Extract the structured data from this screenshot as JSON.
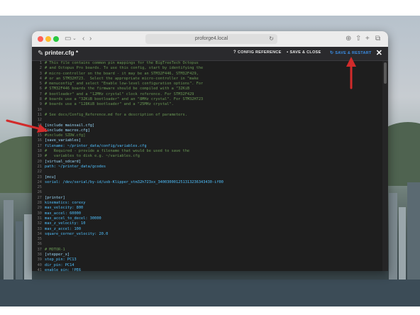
{
  "browser": {
    "url": "proforge4.local"
  },
  "editor": {
    "file_title": "printer.cfg *",
    "buttons": {
      "config_reference": "CONFIG REFERENCE",
      "save_close": "SAVE & CLOSE",
      "save_restart": "SAVE & RESTART"
    },
    "close_label": "✕"
  },
  "code_lines": [
    {
      "n": "1",
      "t": "# This file contains common pin mappings for the BigTreeTech Octopus"
    },
    {
      "n": "2",
      "t": "# and Octopus Pro boards. To use this config, start by identifying the"
    },
    {
      "n": "3",
      "t": "# micro-controller on the board - it may be an STM32F446, STM32F429,"
    },
    {
      "n": "4",
      "t": "# or an STM32H723.  Select the appropriate micro-controller in \"make"
    },
    {
      "n": "5",
      "t": "# menuconfig\" and select \"Enable low-level configuration options\". For"
    },
    {
      "n": "6",
      "t": "# STM32F446 boards the firmware should be compiled with a \"32KiB"
    },
    {
      "n": "7",
      "t": "# bootloader\" and a \"12MHz crystal\" clock reference. For STM32F429"
    },
    {
      "n": "8",
      "t": "# boards use a \"32KiB bootloader\" and an \"8MHz crystal\". For STM32H723"
    },
    {
      "n": "9",
      "t": "# boards use a \"128KiB bootloader\" and a \"25MHz crystal\"."
    },
    {
      "n": "10",
      "t": ""
    },
    {
      "n": "11",
      "t": "# See docs/Config_Reference.md for a description of parameters."
    },
    {
      "n": "12",
      "t": ""
    },
    {
      "n": "13",
      "t": "[include mainsail.cfg]"
    },
    {
      "n": "14",
      "t": "[include macros.cfg]"
    },
    {
      "n": "15",
      "t": "#include SZDW.cfg]"
    },
    {
      "n": "16",
      "t": "[save_variables]"
    },
    {
      "n": "17",
      "t": "filename: ~/printer_data/config/variables.cfg"
    },
    {
      "n": "18",
      "t": "#   Required - provide a filename that would be used to save the"
    },
    {
      "n": "19",
      "t": "#   variables to disk e.g. ~/variables.cfg"
    },
    {
      "n": "20",
      "t": "[virtual_sdcard]"
    },
    {
      "n": "21",
      "t": "path: ~/printer_data/gcodes"
    },
    {
      "n": "22",
      "t": ""
    },
    {
      "n": "23",
      "t": "[mcu]"
    },
    {
      "n": "24",
      "t": "serial: /dev/serial/by-id/usb-Klipper_stm32h723xx_340030001251313236343430-if00"
    },
    {
      "n": "25",
      "t": ""
    },
    {
      "n": "26",
      "t": ""
    },
    {
      "n": "27",
      "t": "[printer]"
    },
    {
      "n": "28",
      "t": "kinematics: corexy"
    },
    {
      "n": "29",
      "t": "max_velocity: 800"
    },
    {
      "n": "30",
      "t": "max_accel: 60000"
    },
    {
      "n": "31",
      "t": "max_accel_to_decel: 30000"
    },
    {
      "n": "32",
      "t": "max_z_velocity: 10"
    },
    {
      "n": "33",
      "t": "max_z_accel: 100"
    },
    {
      "n": "34",
      "t": "square_corner_velocity: 20.0"
    },
    {
      "n": "35",
      "t": ""
    },
    {
      "n": "36",
      "t": ""
    },
    {
      "n": "37",
      "t": "# MOTOR-1"
    },
    {
      "n": "38",
      "t": "[stepper_x]"
    },
    {
      "n": "39",
      "t": "step_pin: PC13"
    },
    {
      "n": "40",
      "t": "dir_pin: PC14"
    },
    {
      "n": "41",
      "t": "enable_pin: !PE6"
    }
  ],
  "colors": {
    "accent": "#3a8ee6",
    "arrow": "#d22b2b"
  }
}
